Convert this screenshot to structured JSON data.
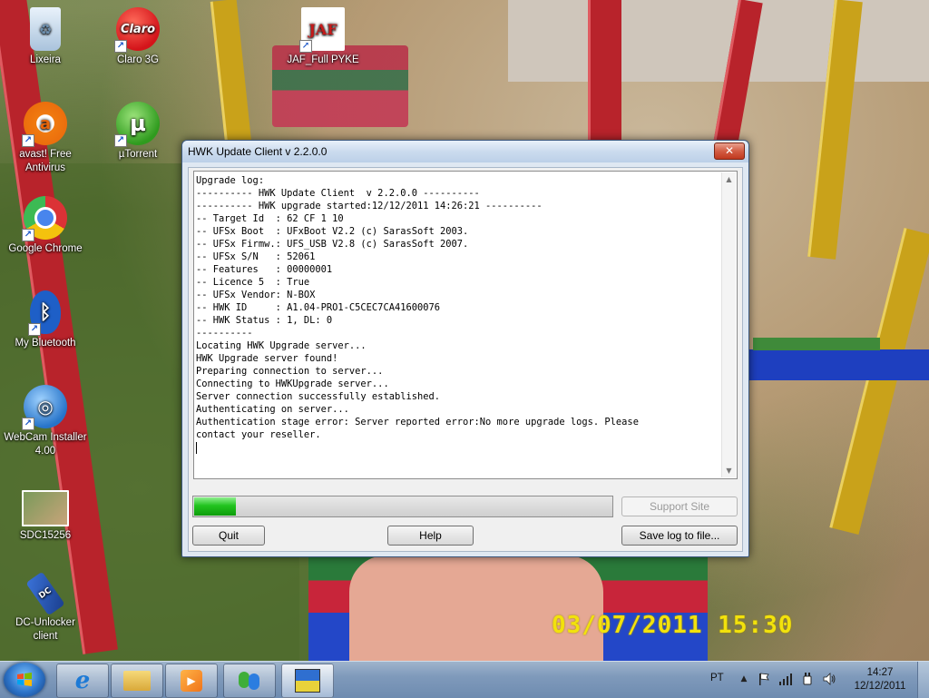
{
  "desktop": {
    "icons": [
      {
        "label": "Lixeira"
      },
      {
        "label": "Claro 3G"
      },
      {
        "label": "JAF_Full PYKE"
      },
      {
        "label": "avast! Free Antivirus"
      },
      {
        "label": "µTorrent"
      },
      {
        "label": "Google Chrome"
      },
      {
        "label": "My Bluetooth"
      },
      {
        "label": "WebCam Installer 4.00"
      },
      {
        "label": "SDC15256"
      },
      {
        "label": "DC-Unlocker client"
      }
    ],
    "photo_stamp": "03/07/2011  15:30"
  },
  "window": {
    "title": "HWK Update Client  v 2.2.0.0",
    "close_label": "✕",
    "log_lines": [
      "Upgrade log:",
      "---------- HWK Update Client  v 2.2.0.0 ----------",
      "---------- HWK upgrade started:12/12/2011 14:26:21 ----------",
      "-- Target Id  : 62 CF 1 10",
      "-- UFSx Boot  : UFxBoot V2.2 (c) SarasSoft 2003.",
      "-- UFSx Firmw.: UFS_USB V2.8 (c) SarasSoft 2007.",
      "-- UFSx S/N   : 52061",
      "-- Features   : 00000001",
      "-- Licence 5  : True",
      "-- UFSx Vendor: N-BOX",
      "-- HWK ID     : A1.04-PRO1-C5CEC7CA41600076",
      "-- HWK Status : 1, DL: 0",
      "----------",
      "Locating HWK Upgrade server...",
      "HWK Upgrade server found!",
      "Preparing connection to server...",
      "Connecting to HWKUpgrade server...",
      "Server connection successfully established.",
      "Authenticating on server...",
      "Authentication stage error: Server reported error:No more upgrade logs. Please",
      "contact your reseller."
    ],
    "progress_fraction": 0.1,
    "buttons": {
      "support_site": "Support Site",
      "quit": "Quit",
      "help": "Help",
      "save_log": "Save log to file..."
    }
  },
  "taskbar": {
    "language": "PT",
    "time": "14:27",
    "date": "12/12/2011",
    "pinned": [
      "internet-explorer-icon",
      "windows-explorer-icon",
      "media-player-icon",
      "messenger-icon",
      "hwk-client-icon"
    ]
  }
}
